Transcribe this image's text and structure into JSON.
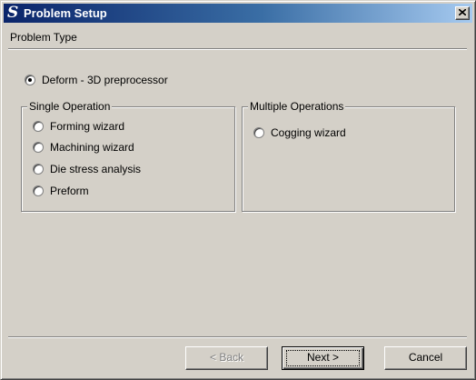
{
  "window": {
    "title": "Problem Setup",
    "close_icon": "close-icon",
    "logo_glyph": "S"
  },
  "header": {
    "label": "Problem Type"
  },
  "options": {
    "deform": {
      "label": "Deform - 3D preprocessor",
      "selected": true
    }
  },
  "single_operation": {
    "legend": "Single Operation",
    "items": [
      {
        "label": "Forming wizard",
        "selected": false
      },
      {
        "label": "Machining wizard",
        "selected": false
      },
      {
        "label": "Die stress analysis",
        "selected": false
      },
      {
        "label": "Preform",
        "selected": false
      }
    ]
  },
  "multiple_operations": {
    "legend": "Multiple Operations",
    "items": [
      {
        "label": "Cogging wizard",
        "selected": false
      }
    ]
  },
  "buttons": {
    "back": {
      "label": "< Back",
      "enabled": false
    },
    "next": {
      "label": "Next >",
      "enabled": true
    },
    "cancel": {
      "label": "Cancel",
      "enabled": true
    }
  }
}
